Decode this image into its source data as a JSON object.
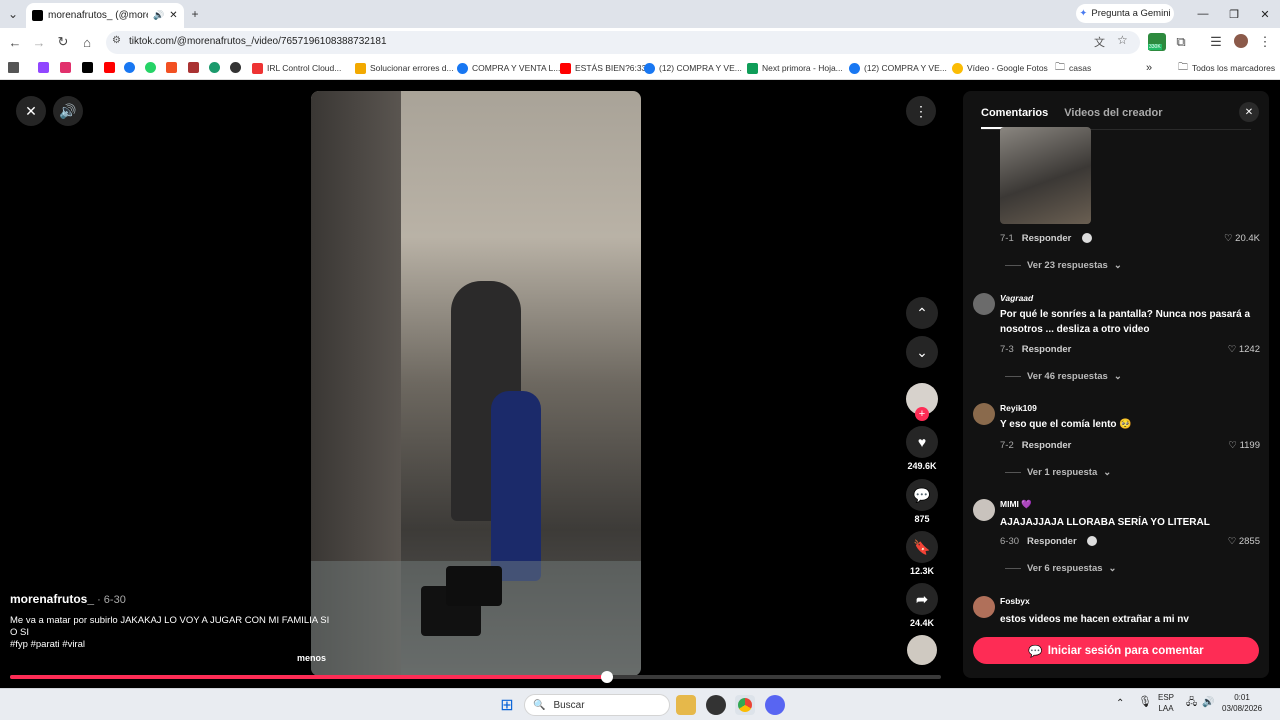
{
  "browser": {
    "tab_title": "morenafrutos_ (@morenafr",
    "new_tab": "+",
    "gemini_label": "Pregunta a Gemini",
    "url": "tiktok.com/@morenafrutos_/video/7657196108388732181",
    "bookmarks": [
      "IRL Control Cloud...",
      "Solucionar errores d...",
      "COMPRA Y VENTA L...",
      "ESTÁS BIEN?6:33",
      "(12) COMPRA Y VE...",
      "Next primora - Hoja...",
      "(12) COMPRA Y VE...",
      "Vídeo - Google Fotos",
      "casas"
    ],
    "all_bookmarks": "Todos los marcadores",
    "extension_badge": "330K"
  },
  "video": {
    "author": "morenafrutos_",
    "date": " · 6-30",
    "caption": "Me va a matar por subirlo JAKAKAJ LO VOY A JUGAR CON MI FAMILIA SI O SI",
    "hashtags": "#fyp #parati #viral",
    "less_label": "menos",
    "likes": "249.6K",
    "comments": "875",
    "saves": "12.3K",
    "shares": "24.4K",
    "progress": 0.641
  },
  "panel": {
    "tab_comments": "Comentarios",
    "tab_creator": "Videos del creador",
    "login_button": "Iniciar sesión para comentar",
    "comments": [
      {
        "user": "",
        "text": "",
        "date": "7-1",
        "reply": "Responder",
        "likes": "20.4K",
        "replies": "Ver 23 respuestas"
      },
      {
        "user": "Vagraad",
        "text": "Por qué le sonríes a la pantalla? Nunca nos pasará a nosotros ... desliza a otro video",
        "date": "7-3",
        "reply": "Responder",
        "likes": "1242",
        "replies": "Ver 46 respuestas"
      },
      {
        "user": "Reyik109",
        "text": "Y eso que el comía lento 🥺",
        "date": "7-2",
        "reply": "Responder",
        "likes": "1199",
        "replies": "Ver 1 respuesta"
      },
      {
        "user": "MIMI 💜",
        "text": "AJAJAJJAJA LLORABA SERÍA YO LITERAL",
        "date": "6-30",
        "reply": "Responder",
        "likes": "2855",
        "replies": "Ver 6 respuestas"
      },
      {
        "user": "Fosbyx",
        "text": "estos videos me hacen extrañar a mi nv",
        "date": "",
        "reply": "",
        "likes": "",
        "replies": ""
      }
    ]
  },
  "taskbar": {
    "search_placeholder": "Buscar",
    "lang": "ESP",
    "lang2": "LAA",
    "time": "0:01",
    "date": "03/08/2026"
  },
  "colors": {
    "accent": "#fe2c55",
    "panel_bg": "#121212"
  }
}
